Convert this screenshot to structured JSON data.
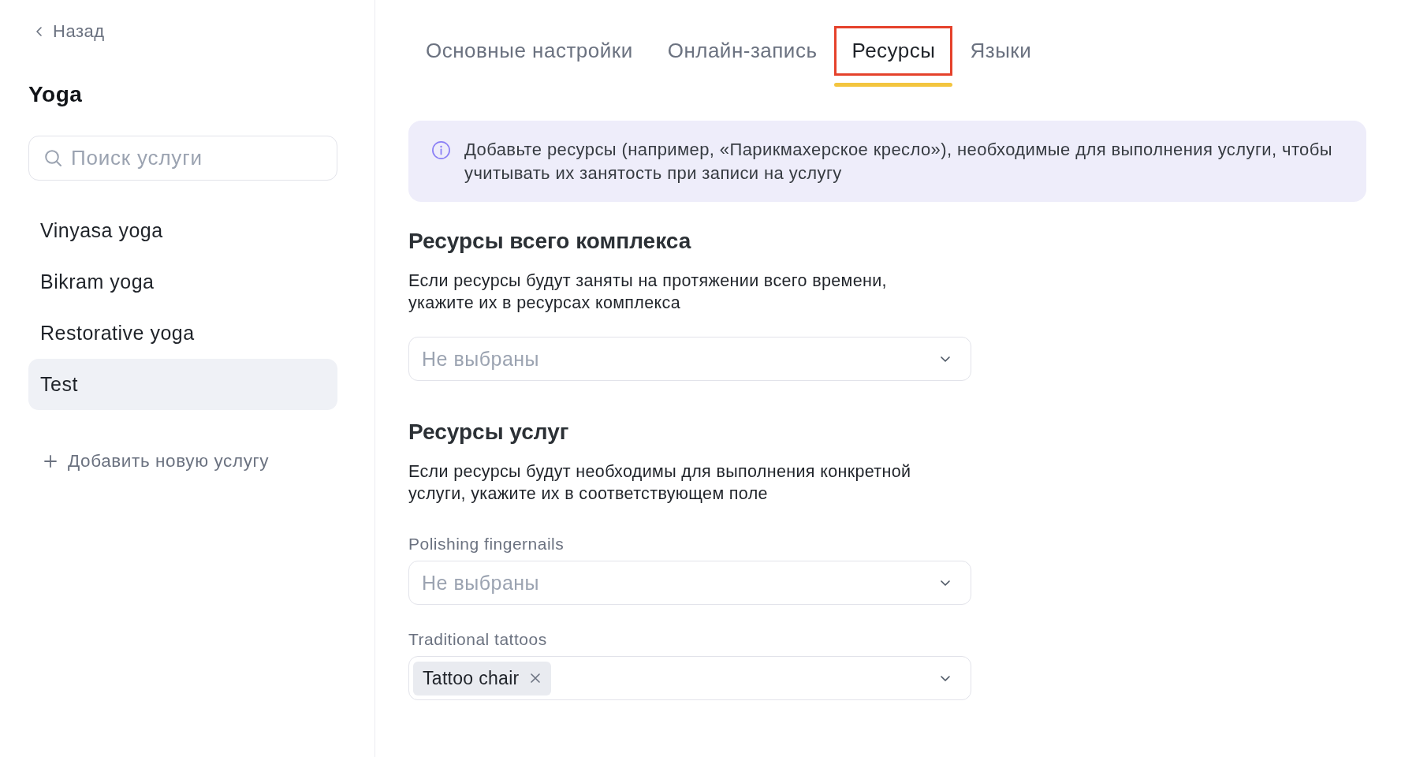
{
  "sidebar": {
    "back_link": {
      "label": "Назад"
    },
    "title": "Yoga",
    "search": {
      "placeholder": "Поиск услуги"
    },
    "services": [
      {
        "name": "Vinyasa yoga",
        "selected": false
      },
      {
        "name": "Bikram yoga",
        "selected": false
      },
      {
        "name": "Restorative yoga",
        "selected": false
      },
      {
        "name": "Test",
        "selected": true
      }
    ],
    "add_service": {
      "label": "Добавить новую услугу"
    }
  },
  "tabs": [
    {
      "label": "Основные настройки",
      "selected": false,
      "highlighted": false
    },
    {
      "label": "Онлайн-запись",
      "selected": false,
      "highlighted": false
    },
    {
      "label": "Ресурсы",
      "selected": true,
      "highlighted": true
    },
    {
      "label": "Языки",
      "selected": false,
      "highlighted": false
    }
  ],
  "info_banner": {
    "text": "Добавьте ресурсы (например, «Парикмахерское кресло»), необходимые для выполнения услуги, чтобы учитывать их занятость при записи на услугу"
  },
  "complex_resources": {
    "title": "Ресурсы всего комплекса",
    "description": "Если ресурсы будут заняты на протяжении всего времени, укажите их в ресурсах комплекса",
    "select": {
      "placeholder": "Не выбраны"
    }
  },
  "service_resources": {
    "title": "Ресурсы услуг",
    "description": "Если ресурсы будут необходимы для выполнения конкретной услуги, укажите их в соответствующем поле",
    "services": [
      {
        "label": "Polishing fingernails",
        "select": {
          "placeholder": "Не выбраны"
        }
      },
      {
        "label": "Traditional tattoos",
        "select": {
          "values": [
            "Tattoo chair"
          ]
        }
      }
    ]
  }
}
